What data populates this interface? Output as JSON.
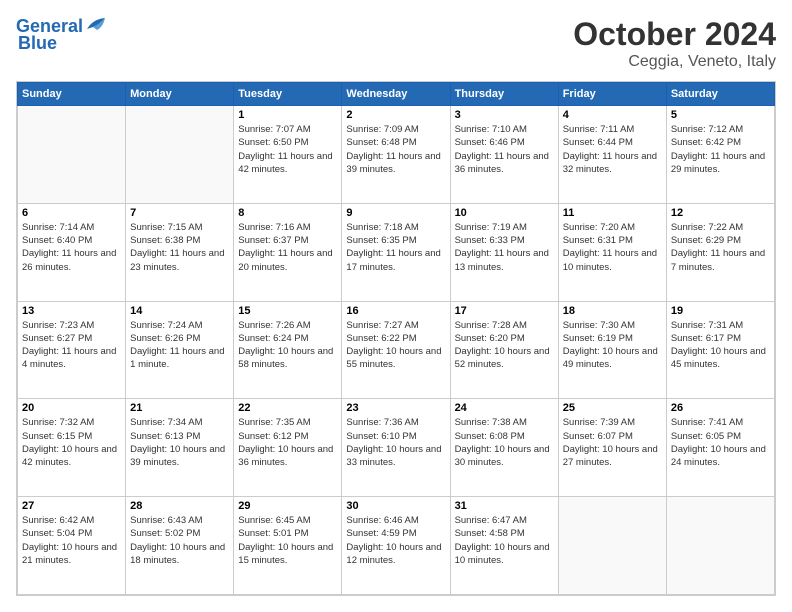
{
  "header": {
    "logo_line1": "General",
    "logo_line2": "Blue",
    "title": "October 2024",
    "subtitle": "Ceggia, Veneto, Italy"
  },
  "weekdays": [
    "Sunday",
    "Monday",
    "Tuesday",
    "Wednesday",
    "Thursday",
    "Friday",
    "Saturday"
  ],
  "weeks": [
    [
      {
        "day": "",
        "info": ""
      },
      {
        "day": "",
        "info": ""
      },
      {
        "day": "1",
        "info": "Sunrise: 7:07 AM\nSunset: 6:50 PM\nDaylight: 11 hours and 42 minutes."
      },
      {
        "day": "2",
        "info": "Sunrise: 7:09 AM\nSunset: 6:48 PM\nDaylight: 11 hours and 39 minutes."
      },
      {
        "day": "3",
        "info": "Sunrise: 7:10 AM\nSunset: 6:46 PM\nDaylight: 11 hours and 36 minutes."
      },
      {
        "day": "4",
        "info": "Sunrise: 7:11 AM\nSunset: 6:44 PM\nDaylight: 11 hours and 32 minutes."
      },
      {
        "day": "5",
        "info": "Sunrise: 7:12 AM\nSunset: 6:42 PM\nDaylight: 11 hours and 29 minutes."
      }
    ],
    [
      {
        "day": "6",
        "info": "Sunrise: 7:14 AM\nSunset: 6:40 PM\nDaylight: 11 hours and 26 minutes."
      },
      {
        "day": "7",
        "info": "Sunrise: 7:15 AM\nSunset: 6:38 PM\nDaylight: 11 hours and 23 minutes."
      },
      {
        "day": "8",
        "info": "Sunrise: 7:16 AM\nSunset: 6:37 PM\nDaylight: 11 hours and 20 minutes."
      },
      {
        "day": "9",
        "info": "Sunrise: 7:18 AM\nSunset: 6:35 PM\nDaylight: 11 hours and 17 minutes."
      },
      {
        "day": "10",
        "info": "Sunrise: 7:19 AM\nSunset: 6:33 PM\nDaylight: 11 hours and 13 minutes."
      },
      {
        "day": "11",
        "info": "Sunrise: 7:20 AM\nSunset: 6:31 PM\nDaylight: 11 hours and 10 minutes."
      },
      {
        "day": "12",
        "info": "Sunrise: 7:22 AM\nSunset: 6:29 PM\nDaylight: 11 hours and 7 minutes."
      }
    ],
    [
      {
        "day": "13",
        "info": "Sunrise: 7:23 AM\nSunset: 6:27 PM\nDaylight: 11 hours and 4 minutes."
      },
      {
        "day": "14",
        "info": "Sunrise: 7:24 AM\nSunset: 6:26 PM\nDaylight: 11 hours and 1 minute."
      },
      {
        "day": "15",
        "info": "Sunrise: 7:26 AM\nSunset: 6:24 PM\nDaylight: 10 hours and 58 minutes."
      },
      {
        "day": "16",
        "info": "Sunrise: 7:27 AM\nSunset: 6:22 PM\nDaylight: 10 hours and 55 minutes."
      },
      {
        "day": "17",
        "info": "Sunrise: 7:28 AM\nSunset: 6:20 PM\nDaylight: 10 hours and 52 minutes."
      },
      {
        "day": "18",
        "info": "Sunrise: 7:30 AM\nSunset: 6:19 PM\nDaylight: 10 hours and 49 minutes."
      },
      {
        "day": "19",
        "info": "Sunrise: 7:31 AM\nSunset: 6:17 PM\nDaylight: 10 hours and 45 minutes."
      }
    ],
    [
      {
        "day": "20",
        "info": "Sunrise: 7:32 AM\nSunset: 6:15 PM\nDaylight: 10 hours and 42 minutes."
      },
      {
        "day": "21",
        "info": "Sunrise: 7:34 AM\nSunset: 6:13 PM\nDaylight: 10 hours and 39 minutes."
      },
      {
        "day": "22",
        "info": "Sunrise: 7:35 AM\nSunset: 6:12 PM\nDaylight: 10 hours and 36 minutes."
      },
      {
        "day": "23",
        "info": "Sunrise: 7:36 AM\nSunset: 6:10 PM\nDaylight: 10 hours and 33 minutes."
      },
      {
        "day": "24",
        "info": "Sunrise: 7:38 AM\nSunset: 6:08 PM\nDaylight: 10 hours and 30 minutes."
      },
      {
        "day": "25",
        "info": "Sunrise: 7:39 AM\nSunset: 6:07 PM\nDaylight: 10 hours and 27 minutes."
      },
      {
        "day": "26",
        "info": "Sunrise: 7:41 AM\nSunset: 6:05 PM\nDaylight: 10 hours and 24 minutes."
      }
    ],
    [
      {
        "day": "27",
        "info": "Sunrise: 6:42 AM\nSunset: 5:04 PM\nDaylight: 10 hours and 21 minutes."
      },
      {
        "day": "28",
        "info": "Sunrise: 6:43 AM\nSunset: 5:02 PM\nDaylight: 10 hours and 18 minutes."
      },
      {
        "day": "29",
        "info": "Sunrise: 6:45 AM\nSunset: 5:01 PM\nDaylight: 10 hours and 15 minutes."
      },
      {
        "day": "30",
        "info": "Sunrise: 6:46 AM\nSunset: 4:59 PM\nDaylight: 10 hours and 12 minutes."
      },
      {
        "day": "31",
        "info": "Sunrise: 6:47 AM\nSunset: 4:58 PM\nDaylight: 10 hours and 10 minutes."
      },
      {
        "day": "",
        "info": ""
      },
      {
        "day": "",
        "info": ""
      }
    ]
  ]
}
